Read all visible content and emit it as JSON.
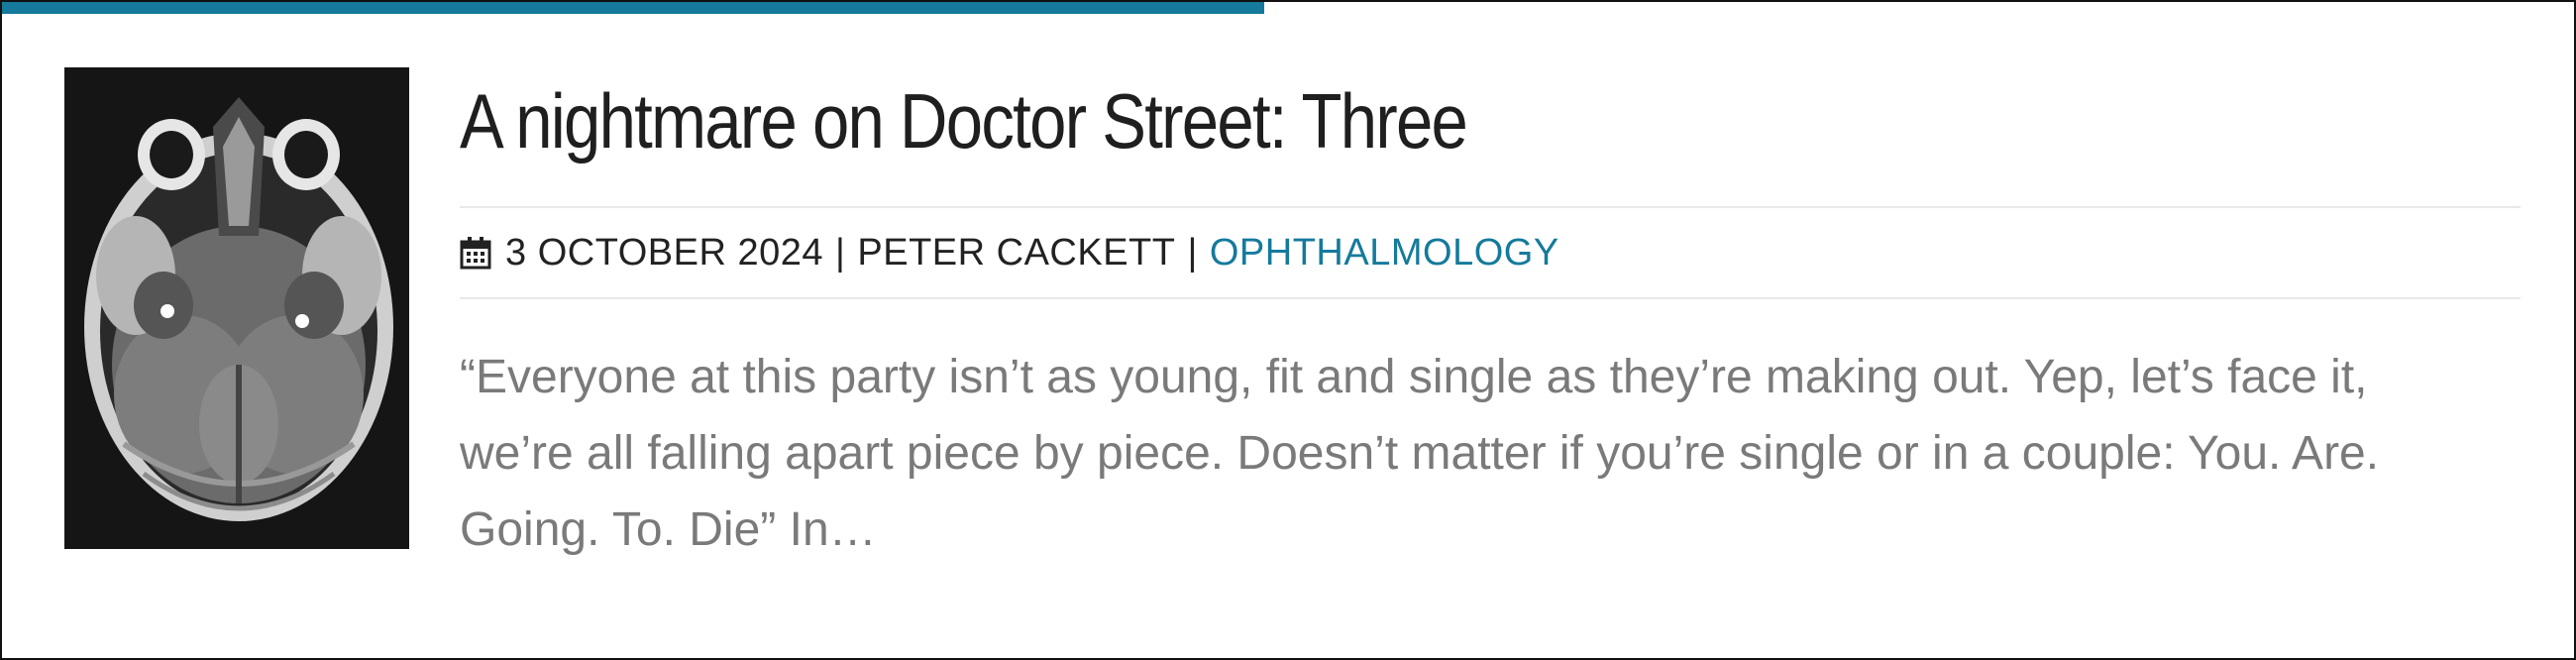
{
  "colors": {
    "accent": "#157a9c",
    "title": "#1f1f1f",
    "meta": "#222222",
    "excerpt": "#7a7a7a",
    "divider": "#e8e8e8"
  },
  "post": {
    "thumbnail_icon": "mri-brain-scan-image",
    "title": "A nightmare on Doctor Street: Three",
    "meta": {
      "date_icon": "calendar-icon",
      "date": "3 OCTOBER 2024",
      "separator": "|",
      "author": "PETER CACKETT",
      "category": "OPHTHALMOLOGY"
    },
    "excerpt": "“Everyone at this party isn’t as young, fit and single as they’re making out. Yep, let’s face it, we’re all falling apart piece by piece. Doesn’t matter if you’re single or in a couple: You. Are. Going. To. Die” In…"
  }
}
